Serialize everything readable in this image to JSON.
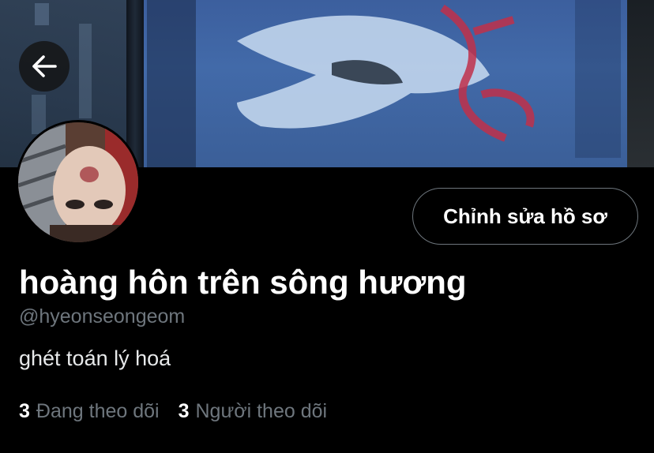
{
  "header": {
    "back_icon": "arrow-left-icon"
  },
  "profile": {
    "display_name": "hoàng hôn trên sông hương",
    "handle": "@hyeonseongeom",
    "bio": "ghét toán lý hoá",
    "edit_button_label": "Chỉnh sửa hồ sơ"
  },
  "stats": [
    {
      "count": "3",
      "label": "Đang theo dõi"
    },
    {
      "count": "3",
      "label": "Người theo dõi"
    }
  ],
  "colors": {
    "background": "#000000",
    "text_primary": "#ffffff",
    "text_secondary": "#6e767d",
    "button_border": "#6e767d"
  }
}
